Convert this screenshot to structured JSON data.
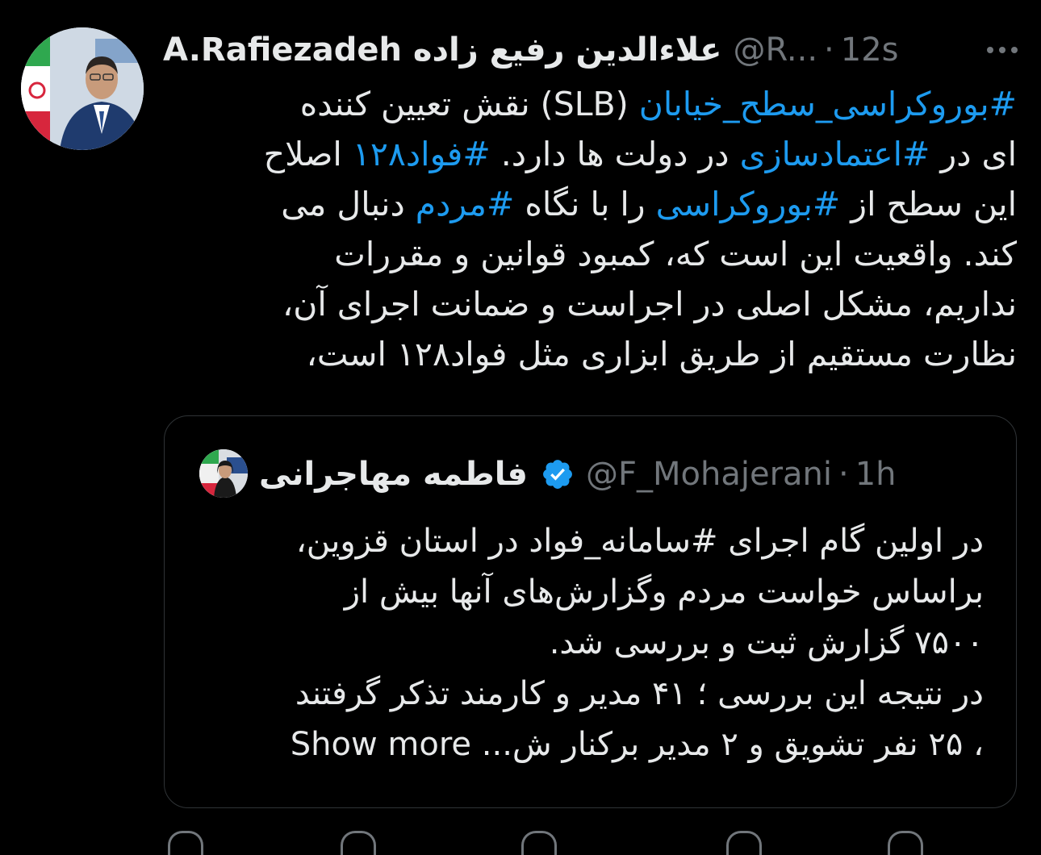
{
  "tweet": {
    "author_name": "A.Rafiezadeh علاءالدین رفیع زاده",
    "author_handle": "@R...",
    "separator": "·",
    "time": "12s",
    "more_label": "···",
    "lines": [
      [
        {
          "t": "#بوروکراسی_سطح_خیابان",
          "tag": true
        },
        {
          "t": " (SLB) نقش تعیین کننده",
          "tag": false
        }
      ],
      [
        {
          "t": "ای در ",
          "tag": false
        },
        {
          "t": "#اعتمادسازی",
          "tag": true
        },
        {
          "t": " در دولت ها دارد. ",
          "tag": false
        },
        {
          "t": "#فواد۱۲۸",
          "tag": true
        },
        {
          "t": " اصلاح",
          "tag": false
        }
      ],
      [
        {
          "t": "این سطح از ",
          "tag": false
        },
        {
          "t": "#بوروکراسی",
          "tag": true
        },
        {
          "t": " را با نگاه ",
          "tag": false
        },
        {
          "t": "#مردم",
          "tag": true
        },
        {
          "t": " دنبال می",
          "tag": false
        }
      ],
      [
        {
          "t": "کند.  واقعیت این است که، کمبود قوانین و مقررات",
          "tag": false
        }
      ],
      [
        {
          "t": "نداریم، مشکل اصلی در اجراست و ضمانت اجرای آن،",
          "tag": false
        }
      ],
      [
        {
          "t": "نظارت مستقیم از طریق ابزاری مثل فواد۱۲۸ است،",
          "tag": false
        }
      ]
    ]
  },
  "quote": {
    "author_name": "فاطمه مهاجرانی",
    "author_handle": "@F_Mohajerani",
    "separator": "·",
    "time": "1h",
    "lines": [
      "در اولین گام اجرای #سامانه_فواد در استان قزوین،",
      "براساس خواست مردم وگزارش‌های آنها بیش از",
      "۷۵۰۰ گزارش ثبت و بررسی شد.",
      "در نتیجه این بررسی ؛ ۴۱ مدیر و کارمند تذکر گرفتند",
      "، ۲۵ نفر تشویق و ۲ مدیر برکنار ش..."
    ],
    "show_more": "Show more"
  },
  "icons": {
    "verified": "verified-badge-icon",
    "more": "more-options-icon"
  },
  "colors": {
    "background": "#000000",
    "text": "#e7e9ea",
    "secondary": "#71767b",
    "accent": "#1d9bf0",
    "border": "#2f3336"
  }
}
